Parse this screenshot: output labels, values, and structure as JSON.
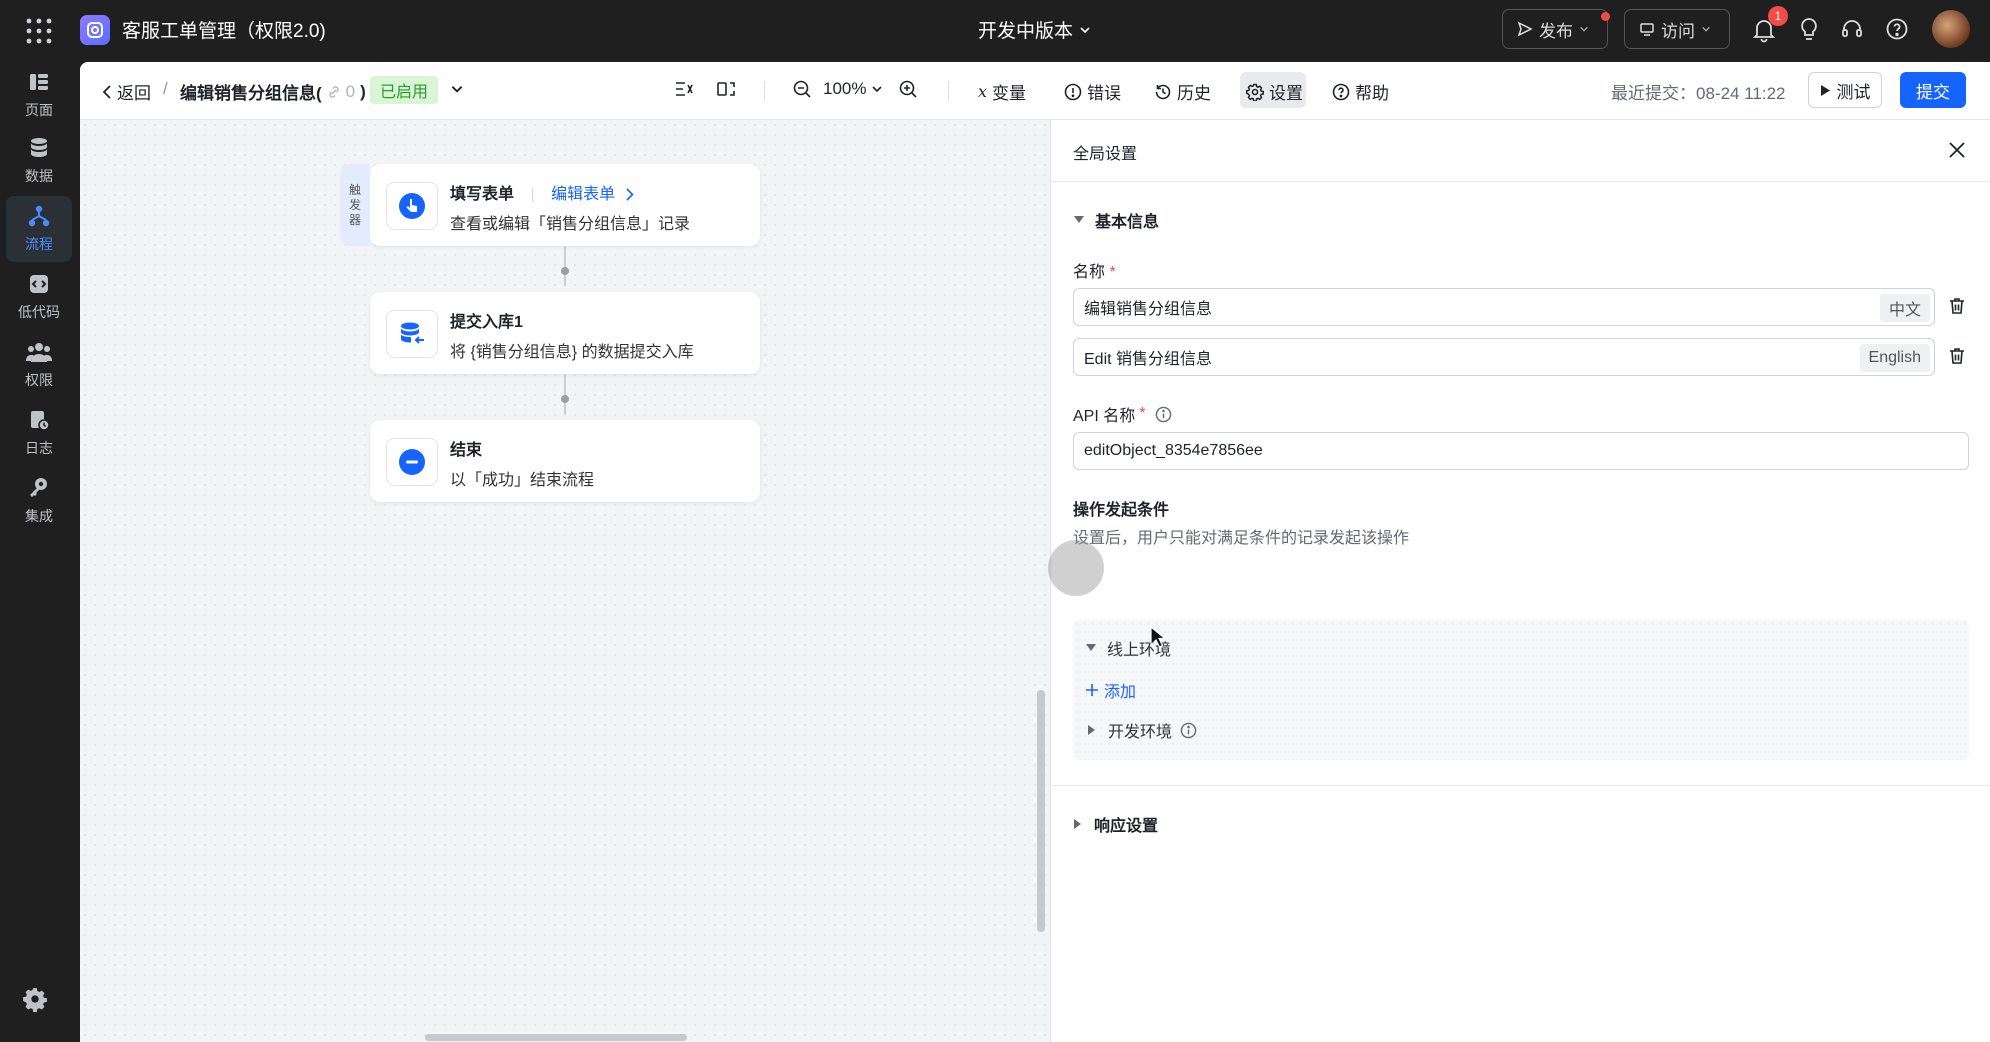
{
  "topbar": {
    "app_title": "客服工单管理（权限2.0)",
    "version": "开发中版本",
    "publish_label": "发布",
    "visit_label": "访问",
    "notification_count": "1"
  },
  "sidebar": {
    "items": [
      {
        "label": "页面",
        "icon": "page-icon"
      },
      {
        "label": "数据",
        "icon": "database-icon"
      },
      {
        "label": "流程",
        "icon": "flow-icon",
        "active": true
      },
      {
        "label": "低代码",
        "icon": "code-icon"
      },
      {
        "label": "权限",
        "icon": "users-icon"
      },
      {
        "label": "日志",
        "icon": "log-icon"
      },
      {
        "label": "集成",
        "icon": "key-icon"
      }
    ]
  },
  "toolbar": {
    "back_label": "返回",
    "separator": "/",
    "flow_name": "编辑销售分组信息(",
    "link_count": "0",
    "flow_name_close": ")",
    "enabled_label": "已启用",
    "zoom": "100%",
    "variables_label": "变量",
    "errors_label": "错误",
    "history_label": "历史",
    "settings_label": "设置",
    "help_label": "帮助",
    "last_submit": "最近提交：08-24 11:22",
    "test_label": "测试",
    "submit_label": "提交"
  },
  "canvas": {
    "nodes": [
      {
        "tag": "触发器",
        "title": "填写表单",
        "link": "编辑表单",
        "desc": "查看或编辑「销售分组信息」记录"
      },
      {
        "title": "提交入库1",
        "desc": "将 {销售分组信息} 的数据提交入库"
      },
      {
        "title": "结束",
        "desc": "以「成功」结束流程"
      }
    ]
  },
  "panel": {
    "title": "全局设置",
    "basic_section": "基本信息",
    "name_label": "名称",
    "required_mark": "*",
    "name_zh": "编辑销售分组信息",
    "name_zh_lang": "中文",
    "name_en": "Edit 销售分组信息",
    "name_en_lang": "English",
    "api_label": "API 名称",
    "api_value": "editObject_8354e7856ee",
    "cond_title": "操作发起条件",
    "cond_desc": "设置后，用户只能对满足条件的记录发起该操作",
    "online_env": "线上环境",
    "add_label": "添加",
    "dev_env": "开发环境",
    "response_section": "响应设置"
  },
  "colors": {
    "primary": "#1664ff",
    "enabled_green": "#2e9a2e",
    "badge_red": "#f54a45",
    "sidebar_bg": "#1f1f1f"
  }
}
